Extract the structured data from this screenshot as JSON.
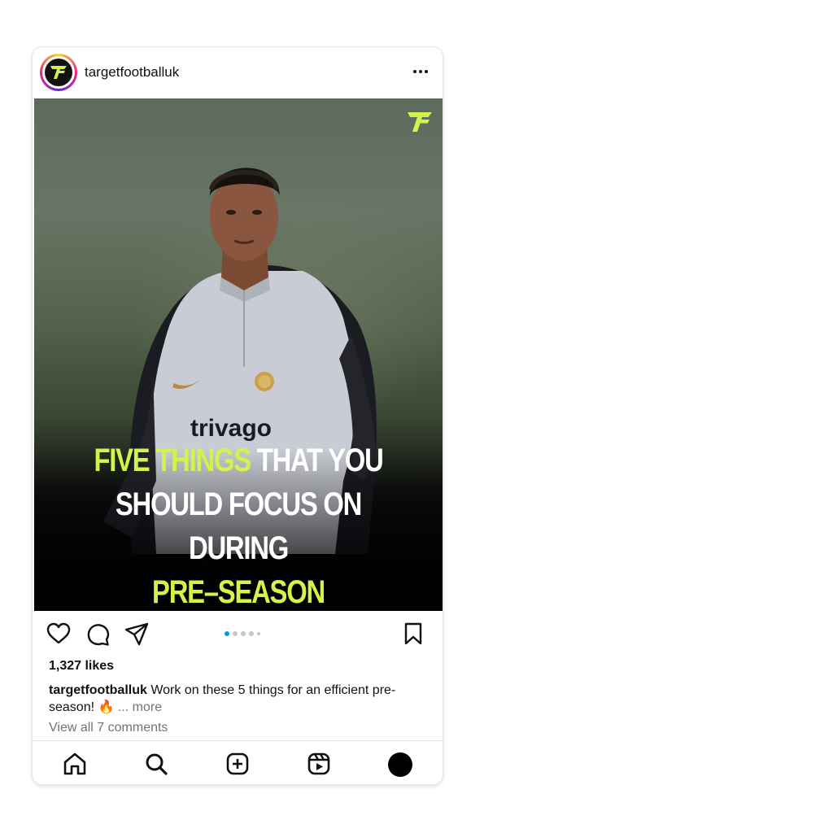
{
  "header": {
    "username": "targetfootballuk",
    "avatar_icon": "target-football-logo-icon",
    "more_icon": "more-options-icon"
  },
  "post": {
    "headline_line1_highlight": "FIVE THINGS",
    "headline_line1_rest": " THAT YOU",
    "headline_line2": "SHOULD FOCUS ON DURING",
    "headline_line3_highlight": "PRE–SEASON",
    "shirt_sponsor": "trivago",
    "accent_color": "#d4f24c",
    "carousel_total": 5,
    "carousel_active_index": 0
  },
  "actions": {
    "like_icon": "heart-icon",
    "comment_icon": "comment-icon",
    "share_icon": "send-icon",
    "save_icon": "bookmark-icon"
  },
  "likes": "1,327 likes",
  "caption": {
    "username": "targetfootballuk",
    "text": " Work on these 5 things for an efficient pre-season! 🔥",
    "more": " ... more"
  },
  "comments_link": "View all 7 comments",
  "bottom_nav": {
    "items": [
      "home-icon",
      "search-icon",
      "create-icon",
      "reels-icon",
      "profile-icon"
    ]
  }
}
